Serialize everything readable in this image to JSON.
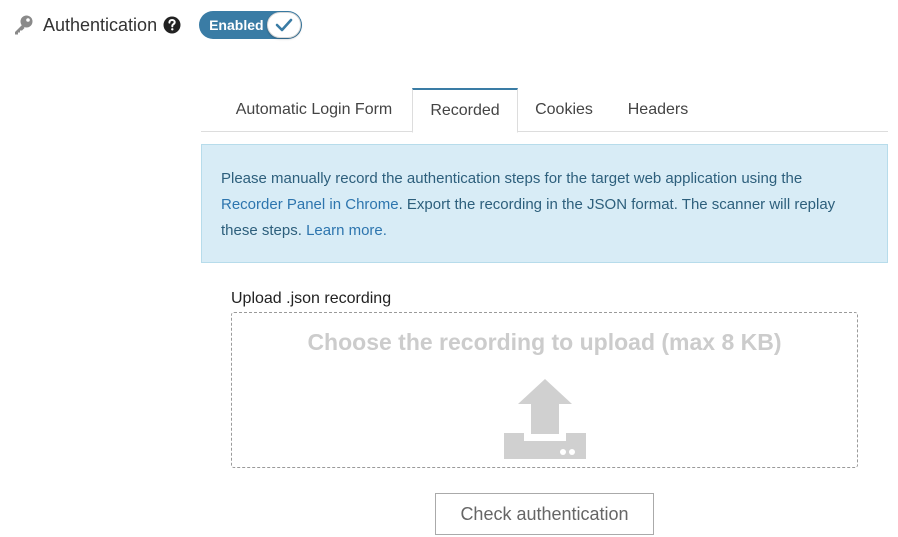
{
  "header": {
    "key_icon": "key-icon",
    "title": "Authentication",
    "help_icon": "question-circle-icon",
    "toggle": {
      "label": "Enabled",
      "state": "on",
      "check_icon": "check-icon"
    }
  },
  "tabs": [
    {
      "label": "Automatic Login Form",
      "active": false
    },
    {
      "label": "Recorded",
      "active": true
    },
    {
      "label": "Cookies",
      "active": false
    },
    {
      "label": "Headers",
      "active": false
    }
  ],
  "alert": {
    "text_1": "Please manually record the authentication steps for the target web application using the ",
    "link_1": "Recorder Panel in Chrome",
    "text_2": ". Export the recording in the JSON format. The scanner will replay these steps. ",
    "link_2": "Learn more."
  },
  "upload": {
    "label": "Upload .json recording",
    "dropzone_text": "Choose the recording to upload (max 8 KB)",
    "icon": "upload-icon"
  },
  "check_button": {
    "label": "Check authentication"
  },
  "colors": {
    "accent": "#3a7ca5",
    "alert_bg": "#d8ecf6",
    "alert_text": "#2d5f7c",
    "link": "#2d75ae",
    "placeholder": "#cccccc"
  }
}
